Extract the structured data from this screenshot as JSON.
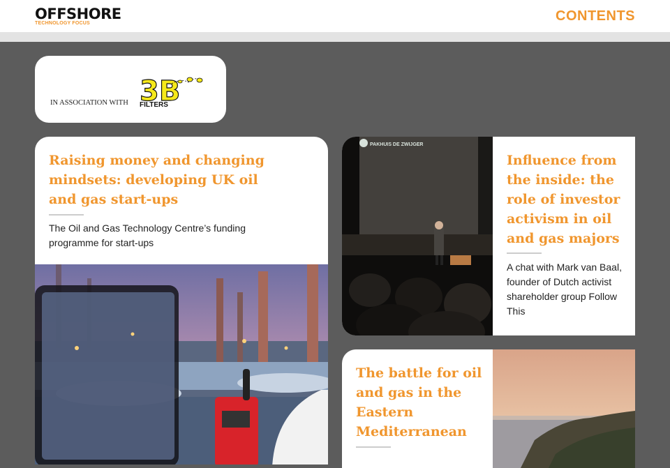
{
  "header": {
    "logo_main": "OFFSHORE",
    "logo_sub": "TECHNOLOGY FOCUS",
    "contents_label": "CONTENTS"
  },
  "sponsor": {
    "label": "IN ASSOCIATION WITH",
    "logo_big": "3B",
    "logo_small": "FILTERS"
  },
  "articles": [
    {
      "title": "Raising money and changing mindsets: developing UK oil and gas start-ups",
      "description": "The Oil and Gas Technology Centre’s funding programme for start-ups"
    },
    {
      "title": "Influence from the inside: the role of investor activism in oil and gas majors",
      "description": "A chat with Mark van Baal, founder of Dutch activist shareholder group Follow This",
      "image_caption": "PAKHUIS DE ZWIJGER"
    },
    {
      "title": "The battle for oil and gas in the Eastern Mediterranean",
      "description": ""
    }
  ],
  "colors": {
    "accent": "#f0962e",
    "background": "#5c5c5c",
    "topstrip": "#e3e3e3"
  }
}
